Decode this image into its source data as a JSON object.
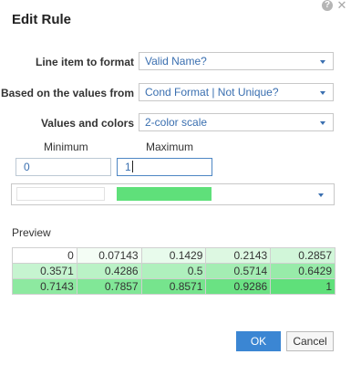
{
  "dialog": {
    "title": "Edit Rule"
  },
  "form": {
    "line_item": {
      "label": "Line item to format",
      "value": "Valid Name?"
    },
    "based_on": {
      "label": "Based on the values from",
      "value": "Cond Format | Not Unique?"
    },
    "values_colors": {
      "label": "Values and colors",
      "value": "2-color scale"
    }
  },
  "scale": {
    "minimum_label": "Minimum",
    "maximum_label": "Maximum",
    "minimum_value": "0",
    "maximum_value": "1",
    "minimum_color": "#ffffff",
    "maximum_color": "#5fe07a"
  },
  "preview": {
    "label": "Preview",
    "rows": [
      [
        "0",
        "0.07143",
        "0.1429",
        "0.2143",
        "0.2857"
      ],
      [
        "0.3571",
        "0.4286",
        "0.5",
        "0.5714",
        "0.6429"
      ],
      [
        "0.7143",
        "0.7857",
        "0.8571",
        "0.9286",
        "1"
      ]
    ]
  },
  "buttons": {
    "ok": "OK",
    "cancel": "Cancel"
  },
  "icons": {
    "help": "help-icon",
    "close": "close-icon",
    "dropdown": "chevron-down-icon"
  },
  "colors": {
    "accent": "#3b86d3",
    "link_text": "#3a6fb0"
  }
}
